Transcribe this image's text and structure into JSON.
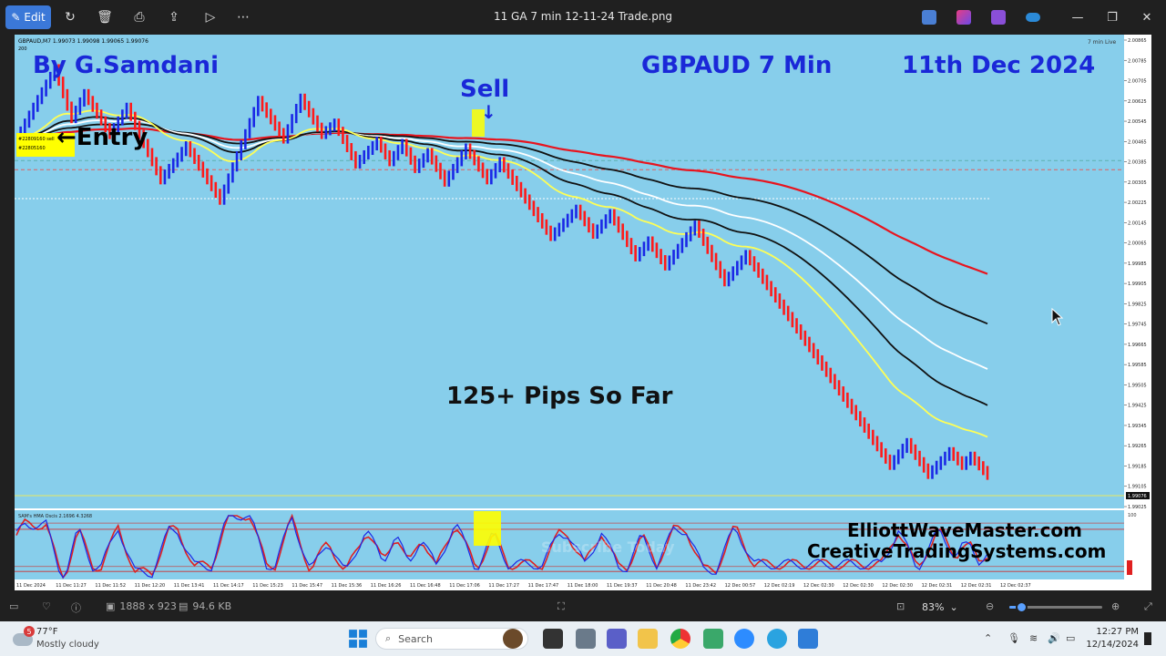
{
  "window": {
    "title": "11 GA 7 min 12-11-24 Trade.png",
    "edit_label": "Edit"
  },
  "chart": {
    "platform_header": "GBPAUD,M7  1.99073 1.99098 1.99065 1.99076",
    "platform_sub": "200",
    "author": "By G.Samdani",
    "symbol_title": "GBPAUD 7 Min",
    "date_title": "11th Dec 2024",
    "sell_label": "Sell",
    "entry_label": "←Entry",
    "result_label": "125+ Pips So Far",
    "order_label_1": "#22809160 sell",
    "order_label_2": "#22805160",
    "corner_label": "7 min Live",
    "current_price": "1.99076",
    "indicator_label": "SAM's HMA Oscis 2.1696 4.3268",
    "website_1": "ElliottWaveMaster.com",
    "website_2": "CreativeTradingSystems.com",
    "watermark": "Subscribe Today",
    "osc_levels": [
      "100",
      "0"
    ],
    "colors": {
      "background": "#87ceeb",
      "bull": "#1a28e6",
      "bear": "#ff1a1a",
      "ma_red": "#e8141e",
      "ma_black": "#111111",
      "ma_white": "#ffffff",
      "ma_yellow": "#ffff55",
      "title": "#1a28d8"
    },
    "price_ticks": [
      "2.00865",
      "2.00785",
      "2.00705",
      "2.00625",
      "2.00545",
      "2.00465",
      "2.00385",
      "2.00305",
      "2.00225",
      "2.00145",
      "2.00065",
      "1.99985",
      "1.99905",
      "1.99825",
      "1.99745",
      "1.99665",
      "1.99585",
      "1.99505",
      "1.99425",
      "1.99345",
      "1.99265",
      "1.99185",
      "1.99105",
      "1.99025"
    ],
    "time_ticks": [
      "11 Dec 2024",
      "11 Dec 11:27",
      "11 Dec 11:52",
      "11 Dec 12:20",
      "11 Dec 13:41",
      "11 Dec 14:17",
      "11 Dec 15:23",
      "11 Dec 15:47",
      "11 Dec 15:36",
      "11 Dec 16:26",
      "11 Dec 16:48",
      "11 Dec 17:06",
      "11 Dec 17:27",
      "11 Dec 17:47",
      "11 Dec 18:00",
      "11 Dec 19:37",
      "11 Dec 20:48",
      "11 Dec 23:42",
      "12 Dec 00:57",
      "12 Dec 02:19",
      "12 Dec 02:30",
      "12 Dec 02:30",
      "12 Dec 02:30",
      "12 Dec 02:31",
      "12 Dec 02:31",
      "12 Dec 02:37"
    ]
  },
  "viewer": {
    "dimensions": "1888 x 923",
    "file_size": "94.6 KB",
    "zoom": "83%",
    "zoom_fraction": 0.13
  },
  "taskbar": {
    "weather_temp": "77°F",
    "weather_cond": "Mostly cloudy",
    "weather_badge": "5",
    "search_placeholder": "Search",
    "time": "12:27 PM",
    "date": "12/14/2024"
  },
  "chart_data": {
    "type": "line",
    "title": "GBPAUD 7 Min",
    "xlabel": "",
    "ylabel": "",
    "ylim": [
      1.9895,
      2.009
    ],
    "price_path": [
      {
        "bar": 0,
        "price": 2.0056
      },
      {
        "bar": 4,
        "price": 2.007
      },
      {
        "bar": 9,
        "price": 2.0087
      },
      {
        "bar": 13,
        "price": 2.0065
      },
      {
        "bar": 16,
        "price": 2.0076
      },
      {
        "bar": 22,
        "price": 2.0058
      },
      {
        "bar": 26,
        "price": 2.007
      },
      {
        "bar": 34,
        "price": 2.0038
      },
      {
        "bar": 40,
        "price": 2.0053
      },
      {
        "bar": 48,
        "price": 2.0029
      },
      {
        "bar": 57,
        "price": 2.0073
      },
      {
        "bar": 63,
        "price": 2.0056
      },
      {
        "bar": 67,
        "price": 2.0074
      },
      {
        "bar": 72,
        "price": 2.0058
      },
      {
        "bar": 75,
        "price": 2.0063
      },
      {
        "bar": 80,
        "price": 2.0045
      },
      {
        "bar": 85,
        "price": 2.0055
      },
      {
        "bar": 88,
        "price": 2.0046
      },
      {
        "bar": 91,
        "price": 2.0054
      },
      {
        "bar": 94,
        "price": 2.0043
      },
      {
        "bar": 97,
        "price": 2.005
      },
      {
        "bar": 101,
        "price": 2.0037
      },
      {
        "bar": 106,
        "price": 2.0052
      },
      {
        "bar": 111,
        "price": 2.0038
      },
      {
        "bar": 114,
        "price": 2.0046
      },
      {
        "bar": 126,
        "price": 2.0013
      },
      {
        "bar": 132,
        "price": 2.0025
      },
      {
        "bar": 136,
        "price": 2.0014
      },
      {
        "bar": 140,
        "price": 2.0023
      },
      {
        "bar": 146,
        "price": 2.0004
      },
      {
        "bar": 149,
        "price": 2.0011
      },
      {
        "bar": 153,
        "price": 2.0
      },
      {
        "bar": 160,
        "price": 2.0018
      },
      {
        "bar": 167,
        "price": 1.9993
      },
      {
        "bar": 172,
        "price": 2.0005
      },
      {
        "bar": 206,
        "price": 1.9912
      },
      {
        "bar": 210,
        "price": 1.9922
      },
      {
        "bar": 215,
        "price": 1.9908
      },
      {
        "bar": 220,
        "price": 1.9918
      },
      {
        "bar": 223,
        "price": 1.9912
      },
      {
        "bar": 225,
        "price": 1.9916
      },
      {
        "bar": 229,
        "price": 1.99076
      }
    ],
    "sell_bar": 114,
    "entry_price": 2.00465,
    "moving_averages": [
      {
        "name": "red",
        "end_price": 1.99965
      },
      {
        "name": "black",
        "end_price": 1.99745
      },
      {
        "name": "white",
        "end_price": 1.99545
      },
      {
        "name": "black2",
        "end_price": 1.99385
      },
      {
        "name": "yellow",
        "end_price": 1.99245
      }
    ]
  }
}
